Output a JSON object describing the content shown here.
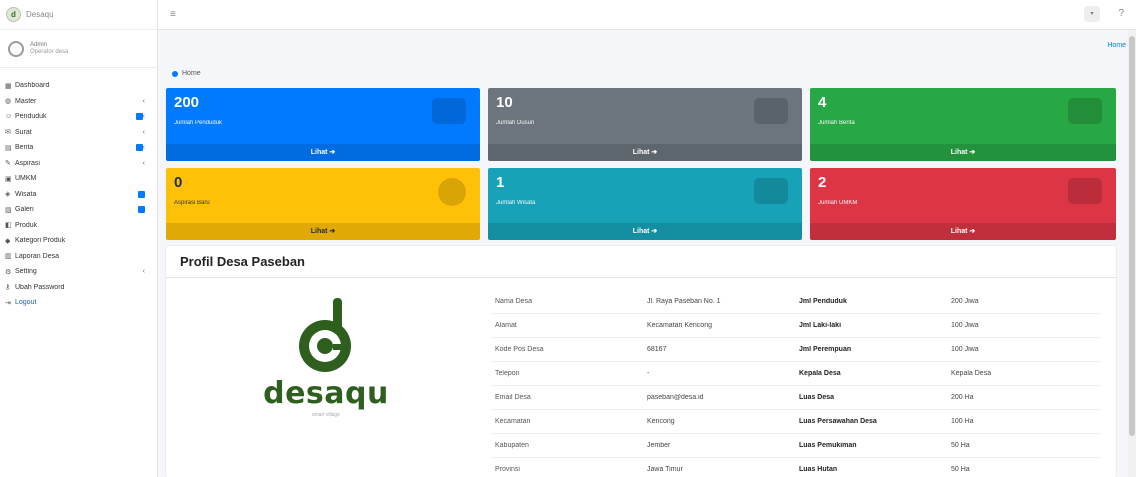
{
  "brand": {
    "title": "Desaqu"
  },
  "user": {
    "name": "Admin",
    "subtitle": "Operator desa"
  },
  "sidebar": {
    "items": [
      {
        "label": "Dashboard",
        "icon": "dashboard-icon",
        "arrow": false,
        "badge": false
      },
      {
        "label": "Master",
        "icon": "database-icon",
        "arrow": true,
        "badge": false
      },
      {
        "label": "Penduduk",
        "icon": "users-icon",
        "arrow": true,
        "badge": true
      },
      {
        "label": "Surat",
        "icon": "mail-icon",
        "arrow": true,
        "badge": false
      },
      {
        "label": "Berita",
        "icon": "news-icon",
        "arrow": true,
        "badge": true
      },
      {
        "label": "Aspirasi",
        "icon": "comment-icon",
        "arrow": true,
        "badge": false
      },
      {
        "label": "UMKM",
        "icon": "store-icon",
        "arrow": false,
        "badge": false
      },
      {
        "label": "Wisata",
        "icon": "map-icon",
        "arrow": false,
        "badge": true
      },
      {
        "label": "Galeri",
        "icon": "image-icon",
        "arrow": false,
        "badge": true
      },
      {
        "label": "Produk",
        "icon": "box-icon",
        "arrow": false,
        "badge": false
      },
      {
        "label": "Kategori Produk",
        "icon": "tag-icon",
        "arrow": false,
        "badge": false
      },
      {
        "label": "Laporan Desa",
        "icon": "file-icon",
        "arrow": false,
        "badge": false
      },
      {
        "label": "Setting",
        "icon": "gear-icon",
        "arrow": true,
        "badge": false
      },
      {
        "label": "Ubah Password",
        "icon": "key-icon",
        "arrow": false,
        "badge": false
      },
      {
        "label": "Logout",
        "icon": "logout-icon",
        "arrow": false,
        "badge": false
      }
    ]
  },
  "topbar": {
    "menu_icon": "≡",
    "help_icon": "?"
  },
  "header": {
    "crumb": "Home",
    "title": "Home"
  },
  "boxes": [
    {
      "value": "200",
      "label": "Jumlah Penduduk",
      "footer": "Lihat",
      "color": "#007bff"
    },
    {
      "value": "10",
      "label": "Jumlah Dusun",
      "footer": "Lihat",
      "color": "#6c757d"
    },
    {
      "value": "4",
      "label": "Jumlah Berita",
      "footer": "Lihat",
      "color": "#28a745"
    },
    {
      "value": "0",
      "label": "Aspirasi Baru",
      "footer": "Lihat",
      "color": "#ffc107"
    },
    {
      "value": "1",
      "label": "Jumlah Wisata",
      "footer": "Lihat",
      "color": "#17a2b8"
    },
    {
      "value": "2",
      "label": "Jumlah UMKM",
      "footer": "Lihat",
      "color": "#dc3545"
    }
  ],
  "profile": {
    "title": "Profil Desa Paseban",
    "logo_text": "desaqu",
    "logo_sub": "smart village",
    "rows": [
      [
        "Nama Desa",
        "Jl. Raya Paseban No. 1",
        "Jml Penduduk",
        "200 Jiwa"
      ],
      [
        "Alamat",
        "Kecamatan Kencong",
        "Jml Laki-laki",
        "100 Jiwa"
      ],
      [
        "Kode Pos Desa",
        "68167",
        "Jml Perempuan",
        "100 Jiwa"
      ],
      [
        "Telepon",
        "-",
        "Kepala Desa",
        "Kepala Desa"
      ],
      [
        "Email Desa",
        "paseban@desa.id",
        "Luas Desa",
        "200 Ha"
      ],
      [
        "Kecamatan",
        "Kencong",
        "Luas Persawahan Desa",
        "100 Ha"
      ],
      [
        "Kabupaten",
        "Jember",
        "Luas Pemukiman",
        "50 Ha"
      ],
      [
        "Provinsi",
        "Jawa Timur",
        "Luas Hutan",
        "50 Ha"
      ]
    ]
  }
}
